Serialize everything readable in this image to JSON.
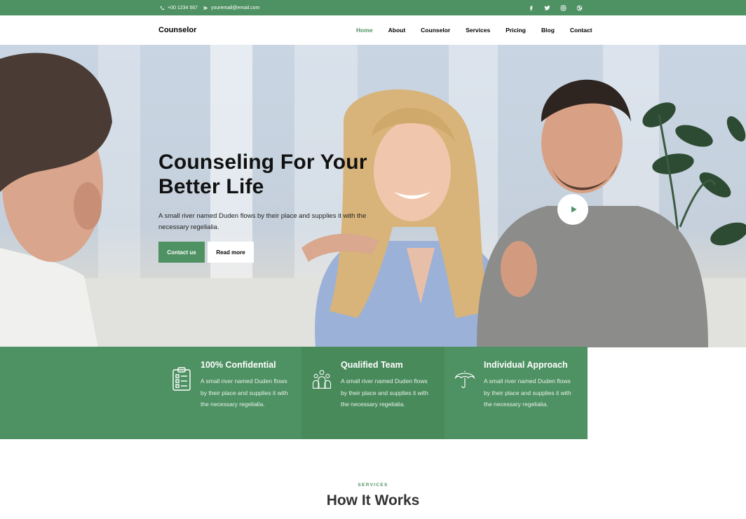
{
  "topbar": {
    "phone": "+00 1234 567",
    "email": "youremail@email.com",
    "social": [
      "facebook-icon",
      "twitter-icon",
      "instagram-icon",
      "dribbble-icon"
    ]
  },
  "navbar": {
    "brand": "Counselor",
    "menu": [
      {
        "label": "Home",
        "active": true
      },
      {
        "label": "About"
      },
      {
        "label": "Counselor"
      },
      {
        "label": "Services"
      },
      {
        "label": "Pricing"
      },
      {
        "label": "Blog"
      },
      {
        "label": "Contact"
      }
    ]
  },
  "hero": {
    "title_line1": "Counseling For Your",
    "title_line2": "Better Life",
    "text": "A small river named Duden flows by their place and supplies it with the necessary regelialia.",
    "btn_contact": "Contact us",
    "btn_read": "Read more"
  },
  "features": [
    {
      "title": "100% Confidential",
      "text": "A small river named Duden flows by their place and supplies it with the necessary regelialia.",
      "icon": "clipboard-checklist-icon"
    },
    {
      "title": "Qualified Team",
      "text": "A small river named Duden flows by their place and supplies it with the necessary regelialia.",
      "icon": "team-icon"
    },
    {
      "title": "Individual Approach",
      "text": "A small river named Duden flows by their place and supplies it with the necessary regelialia.",
      "icon": "umbrella-icon"
    }
  ],
  "services": {
    "label": "SERVICES",
    "title": "How It Works"
  },
  "colors": {
    "accent": "#4e9162",
    "accent_alt": "#498a5b",
    "text_dark": "#333333"
  }
}
